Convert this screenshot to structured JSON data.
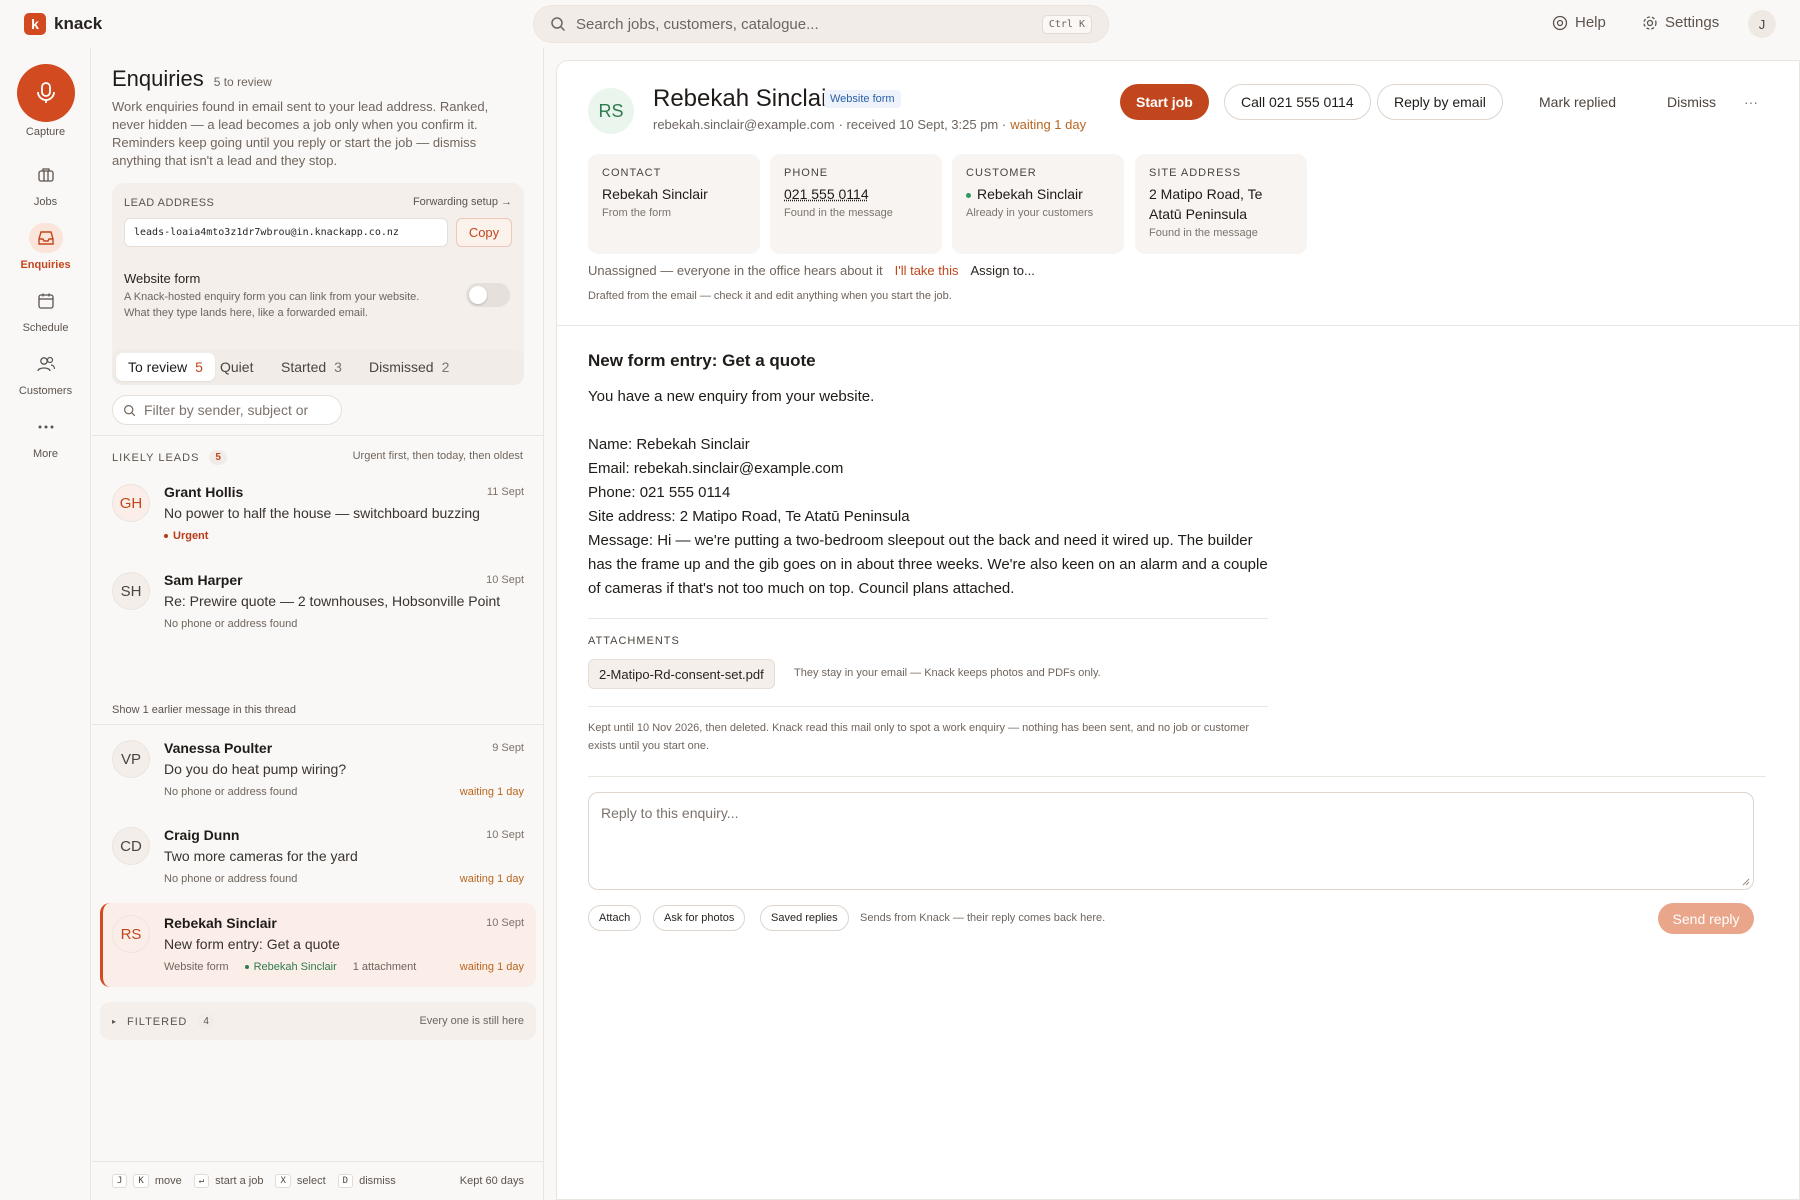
{
  "app": {
    "logo_letter": "k",
    "name": "knack",
    "brand_color": "#d24a1f"
  },
  "search": {
    "placeholder": "Search jobs, customers, catalogue...",
    "shortcut": "Ctrl K"
  },
  "topbar": {
    "help": "Help",
    "settings": "Settings",
    "avatar_initial": "J"
  },
  "nav": {
    "capture": "Capture",
    "items": [
      {
        "label": "Jobs",
        "icon": "briefcase-icon"
      },
      {
        "label": "Enquiries",
        "icon": "inbox-icon",
        "active": true
      },
      {
        "label": "Schedule",
        "icon": "calendar-icon"
      },
      {
        "label": "Customers",
        "icon": "users-icon"
      },
      {
        "label": "More",
        "icon": "more-icon"
      }
    ]
  },
  "enquiries": {
    "title": "Enquiries",
    "subtitle": "5 to review",
    "description": "Work enquiries found in email sent to your lead address. Ranked, never hidden — a lead becomes a job only when you confirm it. Reminders keep going until you reply or start the job — dismiss anything that isn't a lead and they stop.",
    "lead_address": {
      "label": "LEAD ADDRESS",
      "forwarding": "Forwarding setup →",
      "value": "leads-loaia4mto3z1dr7wbrou@in.knackapp.co.nz",
      "copy": "Copy"
    },
    "website_form": {
      "title": "Website form",
      "description": "A Knack-hosted enquiry form you can link from your website. What they type lands here, like a forwarded email.",
      "enabled": false
    },
    "tabs": [
      {
        "label": "To review",
        "count": "5"
      },
      {
        "label": "Quiet",
        "count": ""
      },
      {
        "label": "Started",
        "count": "3"
      },
      {
        "label": "Dismissed",
        "count": "2"
      }
    ],
    "filter_placeholder": "Filter by sender, subject or",
    "likely": {
      "label": "LIKELY LEADS",
      "count": "5",
      "sort": "Urgent first, then today, then oldest"
    },
    "leads": [
      {
        "initials": "GH",
        "name": "Grant Hollis",
        "date": "11 Sept",
        "subject": "No power to half the house — switchboard buzzing",
        "meta": "Urgent",
        "wait": ""
      },
      {
        "initials": "SH",
        "name": "Sam Harper",
        "date": "10 Sept",
        "subject": "Re: Prewire quote — 2 townhouses, Hobsonville Point",
        "meta": "No phone or address found",
        "wait": ""
      },
      {
        "initials": "VP",
        "name": "Vanessa Poulter",
        "date": "9 Sept",
        "subject": "Do you do heat pump wiring?",
        "meta": "No phone or address found",
        "wait": "waiting 1 day"
      },
      {
        "initials": "CD",
        "name": "Craig Dunn",
        "date": "10 Sept",
        "subject": "Two more cameras for the yard",
        "meta": "No phone or address found",
        "wait": "waiting 1 day"
      },
      {
        "initials": "RS",
        "name": "Rebekah Sinclair",
        "date": "10 Sept",
        "subject": "New form entry: Get a quote",
        "source": "Website form",
        "customer": "Rebekah Sinclair",
        "attachments": "1 attachment",
        "wait": "waiting 1 day"
      }
    ],
    "thread_more": "Show 1 earlier message in this thread",
    "filtered": {
      "label": "FILTERED",
      "count": "4",
      "note": "Every one is still here"
    },
    "footer": {
      "k1": "J",
      "k2": "K",
      "move": "move",
      "k3": "↵",
      "start": "start a job",
      "k4": "X",
      "select": "select",
      "k5": "D",
      "dismiss": "dismiss",
      "kept": "Kept 60 days"
    }
  },
  "detail": {
    "initials": "RS",
    "name": "Rebekah Sinclair",
    "badge": "Website form",
    "email": "rebekah.sinclair@example.com",
    "received": "· received 10 Sept, 3:25 pm ·",
    "waiting": "waiting 1 day",
    "actions": {
      "start": "Start job",
      "call": "Call 021 555 0114",
      "reply": "Reply by email",
      "mark": "Mark replied",
      "dismiss": "Dismiss",
      "more": "···"
    },
    "cards": [
      {
        "title": "CONTACT",
        "value": "Rebekah Sinclair",
        "note": "From the form"
      },
      {
        "title": "PHONE",
        "value": "021 555 0114",
        "note": "Found in the message"
      },
      {
        "title": "CUSTOMER",
        "value": "Rebekah Sinclair",
        "note": "Already in your customers"
      },
      {
        "title": "SITE ADDRESS",
        "value": "2 Matipo Road, Te Atatū Peninsula",
        "note": "Found in the message"
      }
    ],
    "assign": {
      "text": "Unassigned — everyone in the office hears about it",
      "take": "I'll take this",
      "to": "Assign to..."
    },
    "drafted": "Drafted from the email — check it and edit anything when you start the job.",
    "message": {
      "title": "New form entry: Get a quote",
      "lines": [
        "You have a new enquiry from your website.",
        "",
        "Name: Rebekah Sinclair",
        "Email: rebekah.sinclair@example.com",
        "Phone: 021 555 0114",
        "Site address: 2 Matipo Road, Te Atatū Peninsula",
        "Message: Hi — we're putting a two-bedroom sleepout out the back and need it wired up. The builder",
        "has the frame up and the gib goes on in about three weeks. We're also keen on an alarm and a couple",
        "of cameras if that's not too much on top. Council plans attached."
      ]
    },
    "attachments": {
      "label": "ATTACHMENTS",
      "file": "2-Matipo-Rd-consent-set.pdf",
      "note": "They stay in your email — Knack keeps photos and PDFs only."
    },
    "kept_note": "Kept until 10 Nov 2026, then deleted. Knack read this mail only to spot a work enquiry — nothing has been sent, and no job or customer exists until you start one.",
    "reply": {
      "placeholder": "Reply to this enquiry...",
      "attach": "Attach",
      "photos": "Ask for photos",
      "saved": "Saved replies",
      "sends": "Sends from Knack — their reply comes back here.",
      "send": "Send reply"
    }
  }
}
